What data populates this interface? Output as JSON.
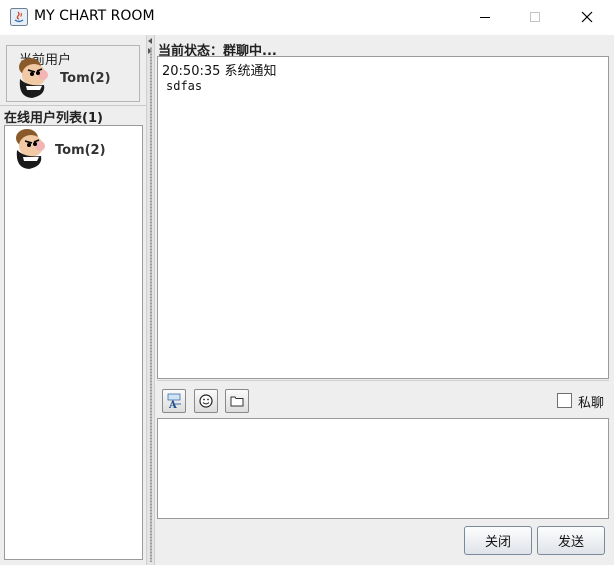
{
  "window": {
    "title": "MY CHART ROOM",
    "controls": [
      "minimize",
      "maximize",
      "close"
    ]
  },
  "current_user": {
    "group_label": "当前用户",
    "name": "Tom(2)",
    "avatar": "bearded-man-avatar"
  },
  "online_users": {
    "title": "在线用户列表(1)",
    "items": [
      {
        "name": "Tom(2)",
        "avatar": "bearded-man-avatar"
      }
    ]
  },
  "chat": {
    "status": "当前状态：群聊中...",
    "messages": [
      {
        "header": "20:50:35 系统通知",
        "body": "sdfas"
      }
    ]
  },
  "toolbar": {
    "buttons": [
      "font-icon",
      "emoticon-icon",
      "folder-icon"
    ],
    "private_label": "私聊",
    "private_checked": false
  },
  "input": {
    "value": ""
  },
  "actions": {
    "close_label": "关闭",
    "send_label": "发送"
  }
}
